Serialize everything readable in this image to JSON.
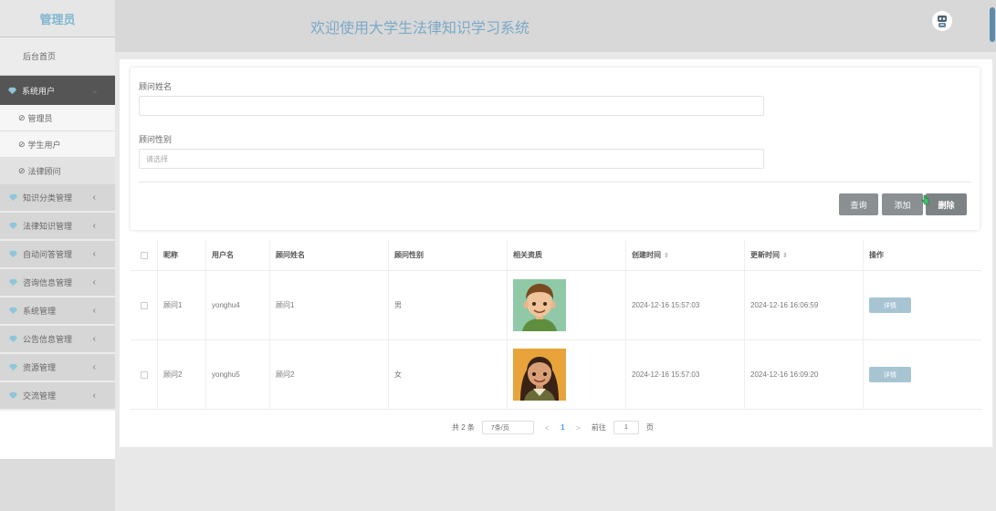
{
  "sidebar": {
    "brand": "管理员",
    "home": "后台首页",
    "active_menu": "系统用户",
    "sub_items": [
      "管理员",
      "学生用户",
      "法律顾问"
    ],
    "menu_items": [
      "知识分类管理",
      "法律知识管理",
      "自动问答管理",
      "咨询信息管理",
      "系统管理",
      "公告信息管理",
      "资源管理",
      "交流管理"
    ]
  },
  "header": {
    "title": "欢迎使用大学生法律知识学习系统"
  },
  "form": {
    "name_label": "顾问姓名",
    "name_value": "",
    "gender_label": "顾问性别",
    "gender_placeholder": "请选择",
    "query_button": "查询",
    "add_button": "添加",
    "delete_button": "删除"
  },
  "table": {
    "headers": [
      "昵称",
      "用户名",
      "顾问姓名",
      "顾问性别",
      "相关资质",
      "创建时间",
      "更新时间",
      "操作"
    ],
    "rows": [
      {
        "nickname": "顾问1",
        "username": "yonghu4",
        "name": "顾问1",
        "gender": "男",
        "created": "2024-12-16 15:57:03",
        "updated": "2024-12-16 16:06:59",
        "action": "详情"
      },
      {
        "nickname": "顾问2",
        "username": "yonghu5",
        "name": "顾问2",
        "gender": "女",
        "created": "2024-12-16 15:57:03",
        "updated": "2024-12-16 16:09:20",
        "action": "详情"
      }
    ]
  },
  "pager": {
    "total": "共 2 条",
    "page_size": "7条/页",
    "prev": "<",
    "current": "1",
    "next": ">",
    "goto_label": "前往",
    "goto_value": "1",
    "page_suffix": "页"
  },
  "icons": {
    "menu": "gem-icon",
    "sub": "circle-check-icon",
    "arrow": "chevron-left-icon",
    "header_avatar": "robot-avatar-icon"
  },
  "colors": {
    "brand": "#7fb7d0",
    "active_menu_bg": "#555555",
    "header_title": "#7aa9c8",
    "detail_button": "#a7c4d3",
    "pager_current": "#409eff"
  }
}
